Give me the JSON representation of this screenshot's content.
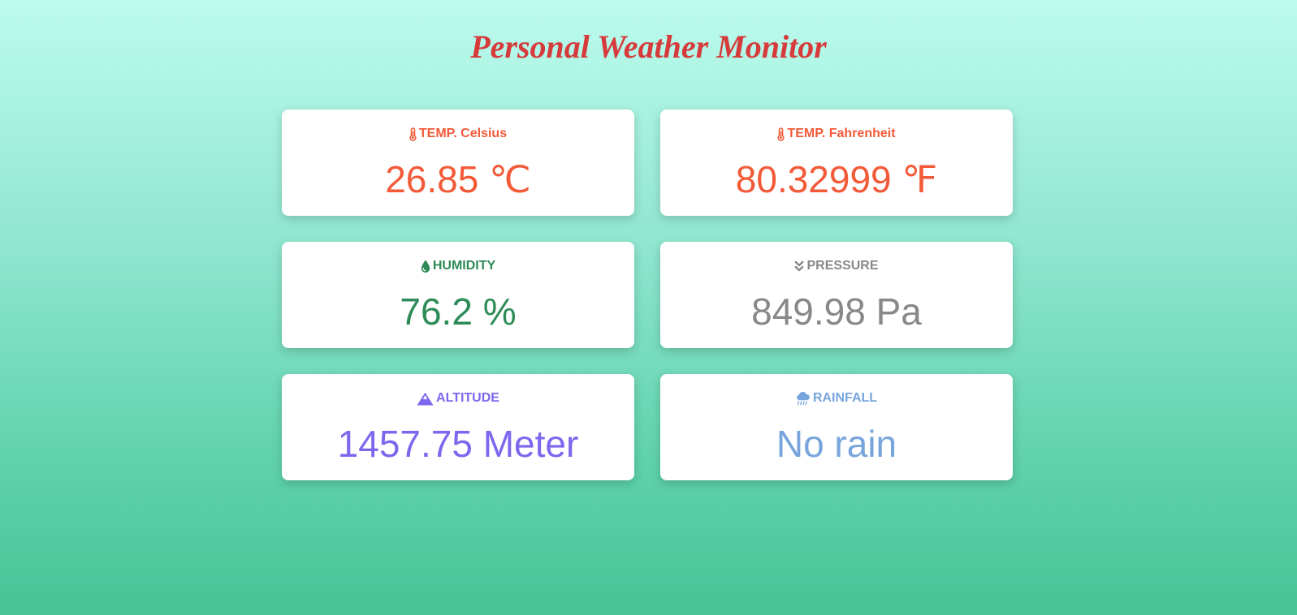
{
  "title": "Personal Weather Monitor",
  "colors": {
    "title": "#d63a3a",
    "temperature": "#f25a38",
    "humidity": "#2e8b57",
    "pressure": "#888888",
    "altitude": "#7b68ee",
    "rainfall": "#77a5dc"
  },
  "cards": [
    {
      "icon": "thermometer-icon",
      "label": "TEMP. Celsius",
      "value": "26.85 ℃"
    },
    {
      "icon": "thermometer-icon",
      "label": "TEMP. Fahrenheit",
      "value": "80.32999 ℉"
    },
    {
      "icon": "droplet-icon",
      "label": "HUMIDITY",
      "value": "76.2 %"
    },
    {
      "icon": "double-chevron-down-icon",
      "label": "PRESSURE",
      "value": "849.98 Pa"
    },
    {
      "icon": "mountain-icon",
      "label": "ALTITUDE",
      "value": "1457.75 Meter"
    },
    {
      "icon": "rain-cloud-icon",
      "label": "RAINFALL",
      "value": "No rain"
    }
  ]
}
